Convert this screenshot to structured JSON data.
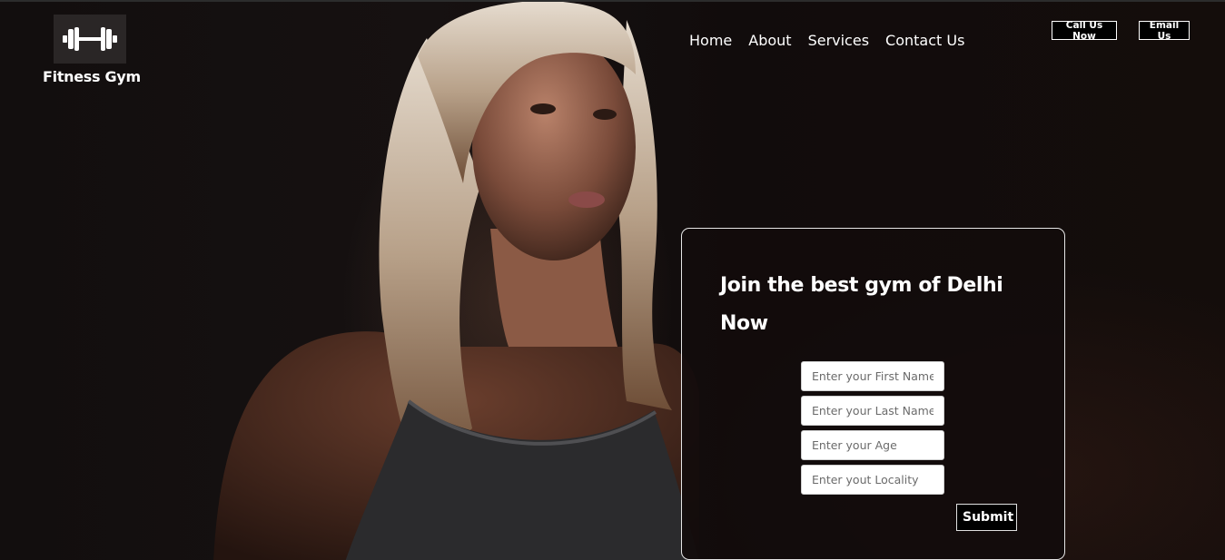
{
  "header": {
    "logo_icon": "dumbbell-icon",
    "brand_name": "Fitness Gym",
    "nav": [
      {
        "label": "Home"
      },
      {
        "label": "About"
      },
      {
        "label": "Services"
      },
      {
        "label": "Contact Us"
      }
    ],
    "call_button": "Call Us Now",
    "email_button": "Email Us"
  },
  "hero": {
    "background_image": "woman-athlete-portrait"
  },
  "form": {
    "title": "Join the best gym of Delhi Now",
    "fields": [
      {
        "placeholder": "Enter your First Name"
      },
      {
        "placeholder": "Enter your Last Name"
      },
      {
        "placeholder": "Enter your Age"
      },
      {
        "placeholder": "Enter yout Locality"
      }
    ],
    "submit_label": "Submit"
  },
  "colors": {
    "background": "#120e0e",
    "text": "#ffffff",
    "button_bg": "#000000"
  }
}
